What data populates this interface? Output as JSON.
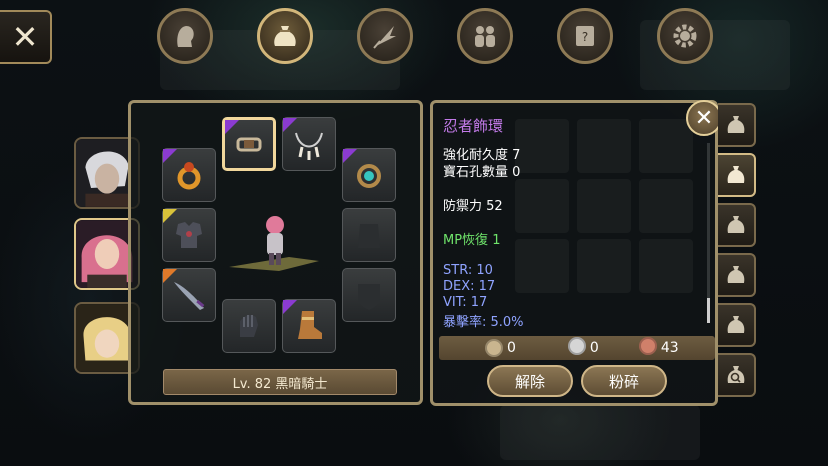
{
  "colors": {
    "frame": "#a0906a",
    "item_name": "#c27ae8",
    "mp": "#6fe46b",
    "stats": "#8fa3ff",
    "rarity_purple": "#8b3bd1",
    "rarity_yellow": "#d9c23a",
    "rarity_orange": "#e07a2a"
  },
  "top_close": {
    "label": "✕"
  },
  "menu_tabs": [
    {
      "icon": "profile-head-icon",
      "active": false
    },
    {
      "icon": "bag-icon",
      "active": true
    },
    {
      "icon": "skill-feather-icon",
      "active": false
    },
    {
      "icon": "party-icon",
      "active": false
    },
    {
      "icon": "quest-scroll-icon",
      "active": false
    },
    {
      "icon": "settings-gear-icon",
      "active": false
    }
  ],
  "characters": [
    {
      "portrait": "white-hair-warrior",
      "active": false
    },
    {
      "portrait": "pink-hair-heroine",
      "active": true
    },
    {
      "portrait": "blonde-girl",
      "active": false
    }
  ],
  "equipment": {
    "level_text": "Lv. 82 黑暗騎士",
    "slots": [
      {
        "icon": "bracelet-icon",
        "rarity": "purple",
        "selected": true
      },
      {
        "icon": "claw-necklace-icon",
        "rarity": "purple"
      },
      {
        "icon": "gold-ring-icon",
        "rarity": "purple"
      },
      {
        "icon": "teal-ring-icon",
        "rarity": "purple"
      },
      {
        "icon": "dark-armor-icon",
        "rarity": "yellow"
      },
      {
        "icon": "empty-armor-slot-icon",
        "rarity": "none"
      },
      {
        "icon": "blade-weapon-icon",
        "rarity": "orange"
      },
      {
        "icon": "empty-shield-slot-icon",
        "rarity": "none"
      },
      {
        "icon": "gauntlet-icon",
        "rarity": "none"
      },
      {
        "icon": "boots-icon",
        "rarity": "purple"
      }
    ]
  },
  "item_info": {
    "name": "忍者飾環",
    "durability": "強化耐久度 7",
    "gem_slots": "寶石孔數量 0",
    "defense": "防禦力 52",
    "mp": "MP恢復 1",
    "str": "STR: 10",
    "dex": "DEX: 17",
    "vit": "VIT: 17",
    "crit": "暴擊率: 5.0%"
  },
  "currency": {
    "gold": "0",
    "silver": "0",
    "copper": "43"
  },
  "buttons": {
    "unequip": "解除",
    "smash": "粉碎"
  },
  "close_panel": {
    "label": "✕"
  },
  "bag_tabs": [
    {
      "icon": "bag-icon",
      "active": false
    },
    {
      "icon": "bag-icon",
      "active": true
    },
    {
      "icon": "bag-icon",
      "active": false
    },
    {
      "icon": "bag-icon",
      "active": false
    },
    {
      "icon": "bag-icon",
      "active": false
    },
    {
      "icon": "search-bag-icon",
      "active": false
    }
  ]
}
